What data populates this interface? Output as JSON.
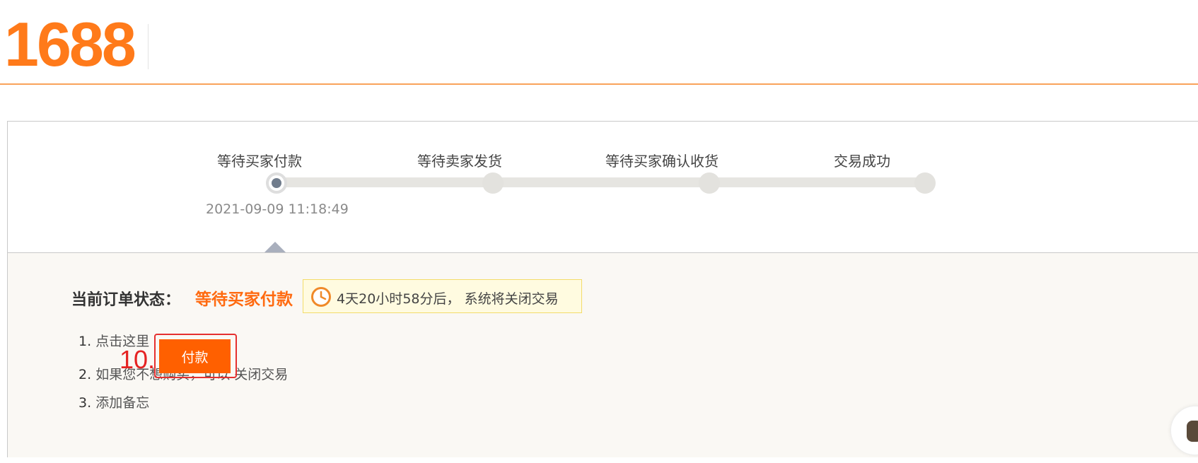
{
  "header": {
    "logo_text": "1688",
    "brand_color": "#ff7a1a"
  },
  "progress": {
    "steps": [
      {
        "label": "等待买家付款",
        "active": true
      },
      {
        "label": "等待卖家发货",
        "active": false
      },
      {
        "label": "等待买家确认收货",
        "active": false
      },
      {
        "label": "交易成功",
        "active": false
      }
    ],
    "first_step_time": "2021-09-09 11:18:49"
  },
  "status": {
    "title": "当前订单状态：",
    "value": "等待买家付款",
    "value_color": "#ff6a10",
    "countdown": {
      "icon": "clock-icon",
      "days": "4",
      "days_unit": "天",
      "hours": "20",
      "hours_unit": "小时",
      "minutes": "58",
      "minutes_suffix": "分后，",
      "message": "系统将关闭交易"
    }
  },
  "actions": {
    "items": [
      {
        "number": "1.",
        "text": "点击这里"
      },
      {
        "number": "2.",
        "text": "如果您不想购买，可以",
        "link": "关闭交易"
      },
      {
        "number": "3.",
        "text": "添加备忘"
      }
    ],
    "pay_button_label": "付款",
    "pay_button_color": "#ff6000"
  },
  "annotation": {
    "step_number": "10."
  }
}
